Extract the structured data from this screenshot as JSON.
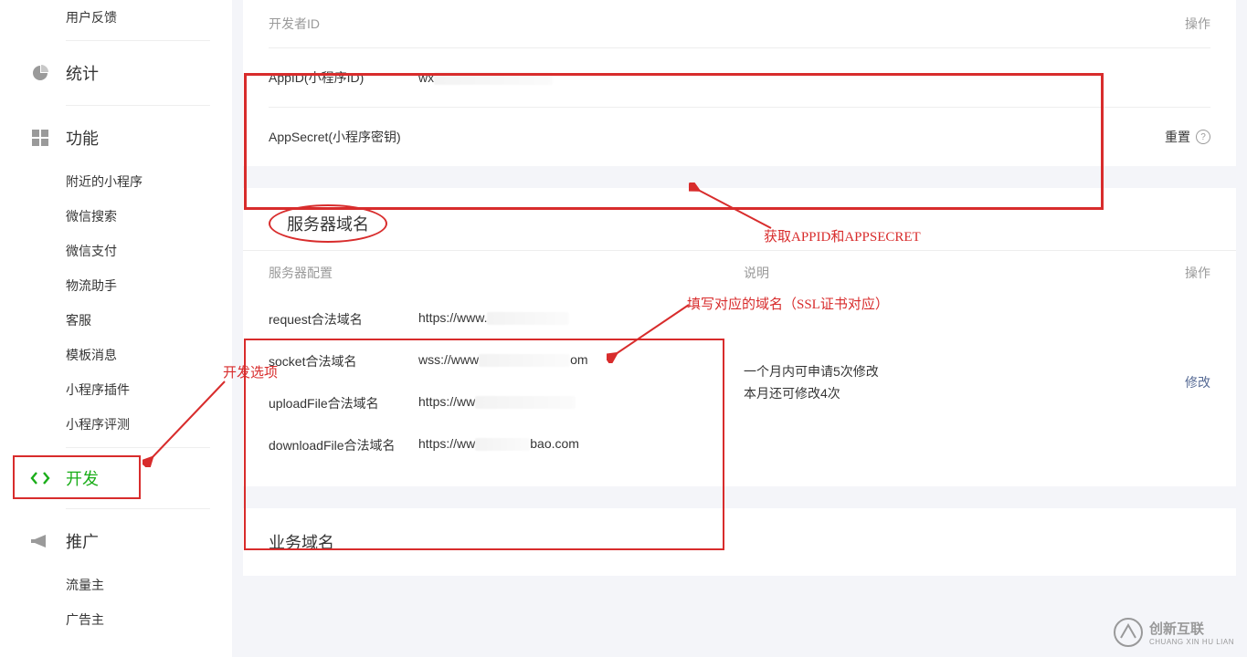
{
  "sidebar": {
    "feedback": "用户反馈",
    "stats": "统计",
    "features": {
      "title": "功能",
      "items": [
        "附近的小程序",
        "微信搜索",
        "微信支付",
        "物流助手",
        "客服",
        "模板消息",
        "小程序插件",
        "小程序评测"
      ]
    },
    "dev": "开发",
    "promotion": {
      "title": "推广",
      "items": [
        "流量主",
        "广告主"
      ]
    }
  },
  "annotations": {
    "dev_option": "开发选项",
    "get_appid": "获取APPID和APPSECRET",
    "fill_domain": "填写对应的域名（SSL证书对应）"
  },
  "developer": {
    "header_id": "开发者ID",
    "header_op": "操作",
    "appid_label": "AppID(小程序ID)",
    "appid_value_prefix": "wx",
    "secret_label": "AppSecret(小程序密钥)",
    "reset": "重置"
  },
  "server": {
    "title": "服务器域名",
    "col_config": "服务器配置",
    "col_desc": "说明",
    "col_op": "操作",
    "rows": [
      {
        "label": "request合法域名",
        "val": "https://www."
      },
      {
        "label": "socket合法域名",
        "val": "wss://www"
      },
      {
        "label": "uploadFile合法域名",
        "val": "https://ww"
      },
      {
        "label": "downloadFile合法域名",
        "val": "https://ww"
      }
    ],
    "desc1": "一个月内可申请5次修改",
    "desc2": "本月还可修改4次",
    "modify": "修改"
  },
  "biz": {
    "title": "业务域名"
  },
  "watermark": {
    "brand": "创新互联",
    "sub": "CHUANG XIN HU LIAN"
  }
}
